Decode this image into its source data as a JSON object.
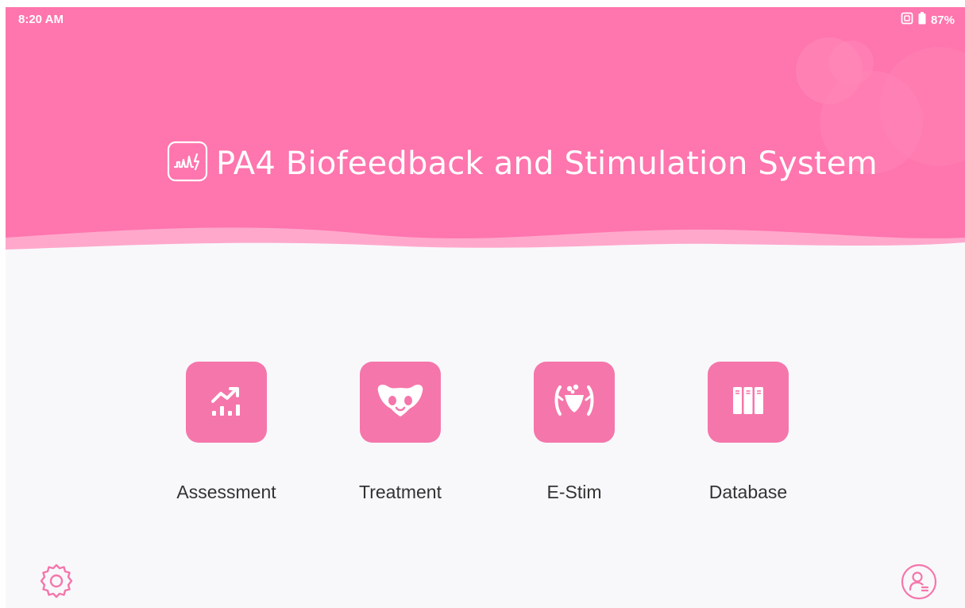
{
  "status_bar": {
    "time": "8:20 AM",
    "battery": "87%",
    "icons": [
      "nfc-icon",
      "battery-icon"
    ]
  },
  "header": {
    "title": "PA4 Biofeedback and Stimulation System",
    "logo_icon": "waveform-logo-icon",
    "color": "#ff75ae"
  },
  "menu": {
    "items": [
      {
        "label": "Assessment",
        "icon": "chart-trend-icon"
      },
      {
        "label": "Treatment",
        "icon": "pelvis-icon"
      },
      {
        "label": "E-Stim",
        "icon": "body-stim-icon"
      },
      {
        "label": "Database",
        "icon": "binders-icon"
      }
    ],
    "tile_color": "#f576ab"
  },
  "footer": {
    "settings_icon": "gear-icon",
    "user_icon": "user-icon"
  },
  "colors": {
    "accent": "#ff75ae",
    "background": "#f8f8fb",
    "text": "#333333"
  }
}
